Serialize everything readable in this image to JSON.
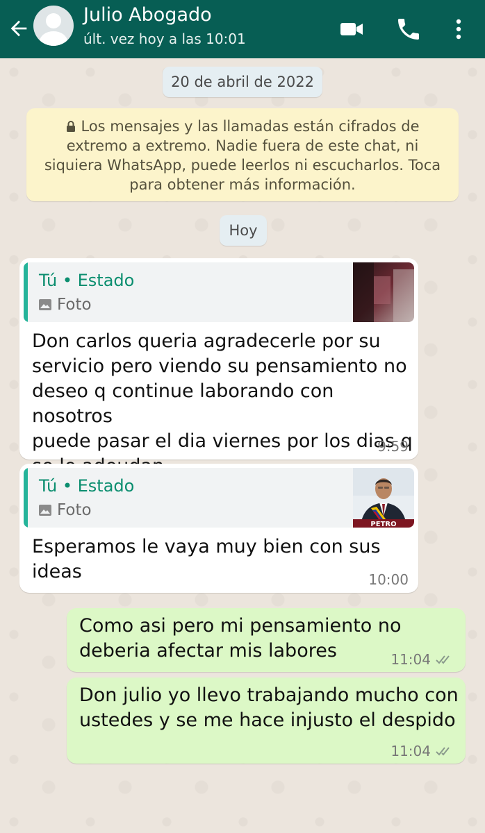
{
  "header": {
    "contact_name": "Julio Abogado",
    "last_seen": "últ. vez hoy a las 10:01"
  },
  "chat": {
    "date_separator": "20 de abril de 2022",
    "encryption_notice": "Los mensajes y las llamadas están cifrados de extremo a extremo. Nadie fuera de este chat, ni siquiera WhatsApp, puede leerlos ni escucharlos. Toca para obtener más información.",
    "today_separator": "Hoy",
    "messages": [
      {
        "direction": "incoming",
        "quote_author": "Tú • Estado",
        "quote_type": "Foto",
        "text_lines": [
          "Don carlos queria agradecerle por su",
          "servicio pero viendo su pensamiento no",
          "deseo q continue laborando con nosotros",
          "puede pasar el dia viernes por los dias q",
          "se le adeudan"
        ],
        "time": "9:59"
      },
      {
        "direction": "incoming",
        "quote_author": "Tú • Estado",
        "quote_type": "Foto",
        "thumb_label": "PETRO",
        "text_lines": [
          "Esperamos le vaya muy bien con sus",
          "ideas"
        ],
        "time": "10:00"
      },
      {
        "direction": "outgoing",
        "text_lines": [
          "Como asi pero mi pensamiento no",
          "deberia afectar mis labores"
        ],
        "time": "11:04"
      },
      {
        "direction": "outgoing",
        "text_lines": [
          "Don julio yo llevo trabajando mucho con",
          "ustedes y se me hace injusto el despido"
        ],
        "time": "11:04"
      }
    ]
  },
  "colors": {
    "header": "#075e54",
    "outgoing_bubble": "#dcf8c6",
    "incoming_bubble": "#ffffff",
    "quote_accent": "#25b49a"
  },
  "icons": [
    "back-arrow-icon",
    "avatar-icon",
    "video-call-icon",
    "phone-icon",
    "more-options-icon",
    "lock-icon",
    "photo-icon",
    "double-check-icon"
  ]
}
